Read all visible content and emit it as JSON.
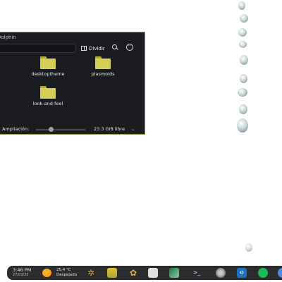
{
  "window": {
    "title": "Dolphin",
    "toolbar": {
      "split_label": "Dividir"
    },
    "items": [
      {
        "name": "desktoptheme",
        "type": "folder"
      },
      {
        "name": "plasmoids",
        "type": "folder"
      },
      {
        "name": "look-and-feel",
        "type": "folder"
      }
    ],
    "status": {
      "zoom_label": "Ampliación:",
      "free_space": "23.3 GiB libre",
      "zoom_level": 0.3
    }
  },
  "taskbar": {
    "time": "3:46 PM",
    "date": "27/03/25",
    "weather_temp": "25.4 °C",
    "weather_desc": "Despejado",
    "apps": [
      "kde-launcher-icon",
      "file-manager-icon",
      "settings-icon",
      "store-icon",
      "image-viewer-icon",
      "terminal-icon",
      "system-settings-icon",
      "outlook-icon",
      "spotify-icon",
      "app-icon"
    ]
  },
  "colors": {
    "accent": "#8f9b34",
    "folder": "#d6cf55",
    "window_bg": "#1b1c1f",
    "taskbar_bg": "#181a1c"
  }
}
